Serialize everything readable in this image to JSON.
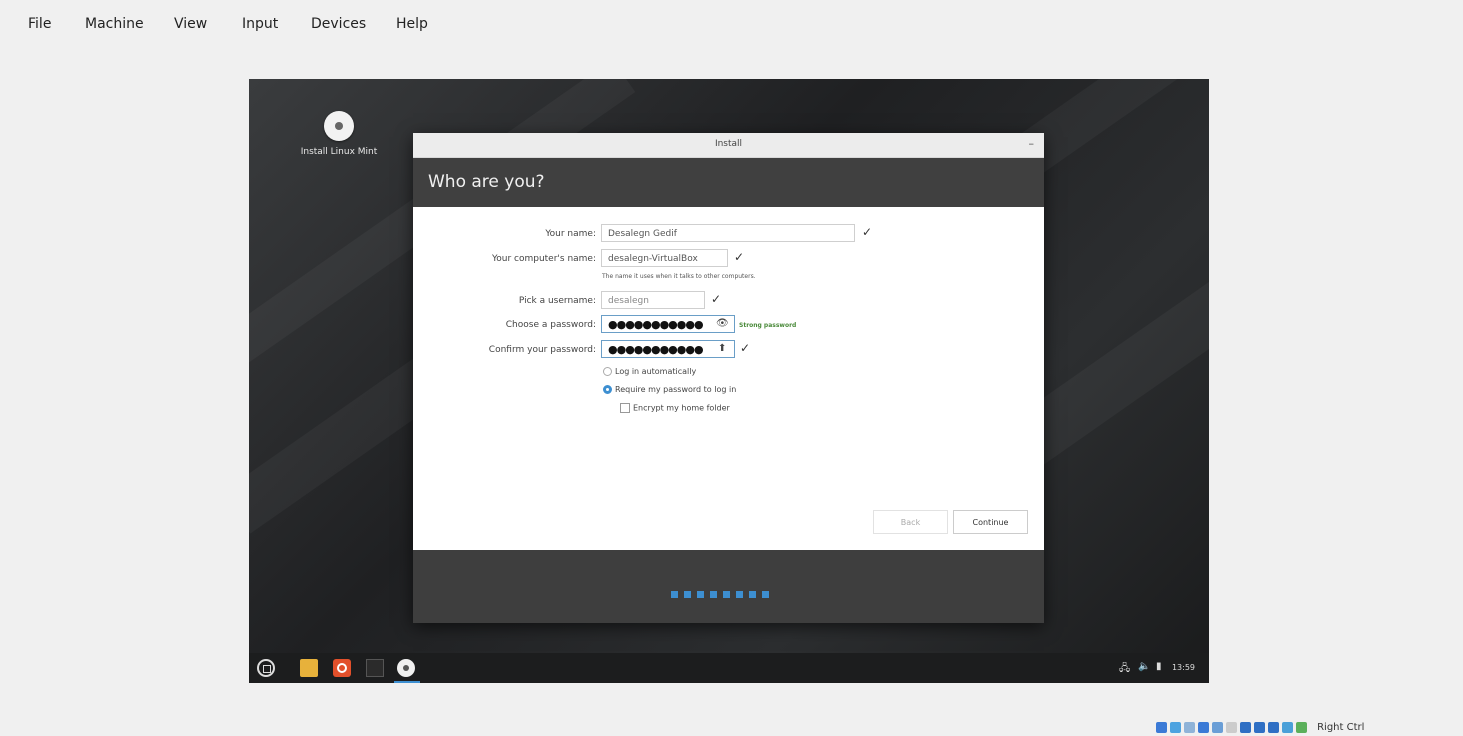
{
  "host_menu": [
    "File",
    "Machine",
    "View",
    "Input",
    "Devices",
    "Help"
  ],
  "desktop": {
    "install_icon_label": "Install Linux Mint"
  },
  "window": {
    "title": "Install",
    "minimize_glyph": "–",
    "heading": "Who are you?"
  },
  "form": {
    "your_name": {
      "label": "Your name:",
      "value": "Desalegn Gedif"
    },
    "computer_name": {
      "label": "Your computer's name:",
      "value": "desalegn-VirtualBox",
      "hint": "The name it uses when it talks to other computers."
    },
    "username": {
      "label": "Pick a username:",
      "value": "desalegn"
    },
    "password": {
      "label": "Choose a password:",
      "masked": "●●●●●●●●●●●",
      "strength": "Strong password"
    },
    "confirm": {
      "label": "Confirm your password:",
      "masked": "●●●●●●●●●●●"
    },
    "check_glyph": "✓",
    "eye_glyph": "👁",
    "caps_glyph": "⬆",
    "login_auto": "Log in automatically",
    "require_password": "Require my password to log in",
    "encrypt_home": "Encrypt my home folder"
  },
  "buttons": {
    "back": "Back",
    "continue": "Continue"
  },
  "progress": {
    "steps_total": 8
  },
  "taskbar": {
    "network_glyph": "🖧",
    "volume_glyph": "🔈",
    "battery_glyph": "▮",
    "clock": "13:59"
  },
  "statusbar": {
    "host_key": "Right Ctrl",
    "icon_colors": [
      "#3b7ad6",
      "#4da3e0",
      "#8fb3d8",
      "#3b7ad6",
      "#6a9ed6",
      "#cccccc",
      "#2f6fc4",
      "#2f6fc4",
      "#2f6fc4",
      "#4aa0d8",
      "#5bb05b"
    ]
  },
  "colors": {
    "accent": "#3d8fd1",
    "heading_bg": "#404040",
    "strong": "#4a8a3a"
  }
}
